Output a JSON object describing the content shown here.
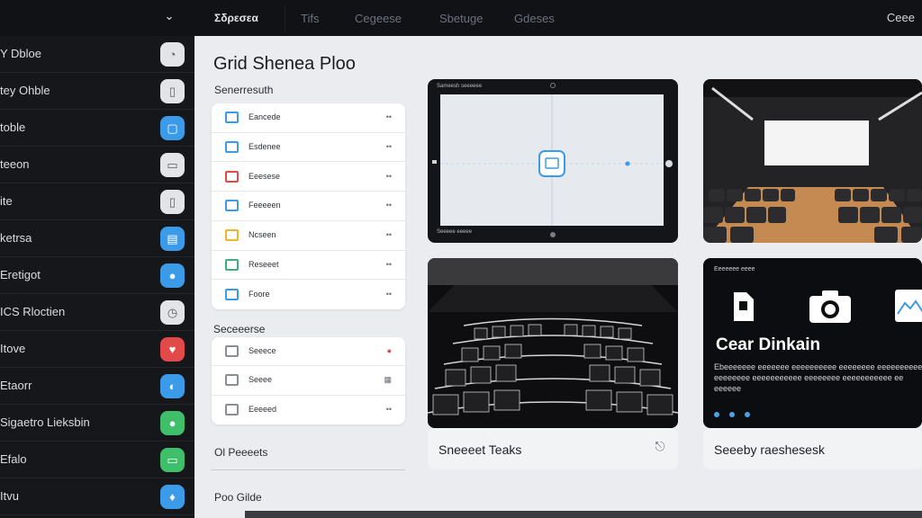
{
  "topbar": {
    "tabs": [
      "Σδρεσεα",
      "Tifs",
      "Cegeese",
      "Sbetuge",
      "Gdeses"
    ],
    "right": "Ceee"
  },
  "sidebar": {
    "items": [
      {
        "label": "Y Dbloe",
        "icon": "note-icon",
        "color": "#e3e4e7",
        "glyph": "◔"
      },
      {
        "label": "tey Ohble",
        "icon": "device-icon",
        "color": "#e3e4e7",
        "glyph": "▯"
      },
      {
        "label": "toble",
        "icon": "app-icon",
        "color": "#3c9be8",
        "glyph": "▢"
      },
      {
        "label": "teeon",
        "icon": "keyboard-icon",
        "color": "#e3e4e7",
        "glyph": "▭"
      },
      {
        "label": "ite",
        "icon": "phone-icon",
        "color": "#e3e4e7",
        "glyph": "▯"
      },
      {
        "label": "ketrsa",
        "icon": "doc-icon",
        "color": "#3c9be8",
        "glyph": "▤"
      },
      {
        "label": "Eretigot",
        "icon": "chat-icon",
        "color": "#3c9be8",
        "glyph": "●"
      },
      {
        "label": "ICS Rloctien",
        "icon": "clock-icon",
        "color": "#e3e4e7",
        "glyph": "◷"
      },
      {
        "label": "Itove",
        "icon": "heart-icon",
        "color": "#e24a4a",
        "glyph": "♥"
      },
      {
        "label": "Etaorr",
        "icon": "chat-icon",
        "color": "#3c9be8",
        "glyph": "◐"
      },
      {
        "label": "Sigaetro Lieksbin",
        "icon": "message-icon",
        "color": "#3fbf6a",
        "glyph": "●"
      },
      {
        "label": "Efalo",
        "icon": "chat-icon",
        "color": "#3fbf6a",
        "glyph": "▭"
      },
      {
        "label": "Itvu",
        "icon": "tooth-icon",
        "color": "#3c9be8",
        "glyph": "♦"
      }
    ]
  },
  "main": {
    "title": "Grid Shenea Ploo",
    "section1": "Senerresuth",
    "list1": [
      {
        "label": "Eancede",
        "end": "••",
        "color": "#3c9be8"
      },
      {
        "label": "Esdenee",
        "end": "••",
        "color": "#3c9be8"
      },
      {
        "label": "Eeesese",
        "end": "••",
        "color": "#e24a4a"
      },
      {
        "label": "Feeeeen",
        "end": "••",
        "color": "#3c9be8"
      },
      {
        "label": "Ncseen",
        "end": "••",
        "color": "#f0b32a"
      },
      {
        "label": "Reseeet",
        "end": "••",
        "color": "#3fae7b"
      },
      {
        "label": "Foore",
        "end": "••",
        "color": "#3c9be8"
      }
    ],
    "section2": "Seceeerse",
    "list2": [
      {
        "label": "Seeece",
        "end": "●",
        "color": "#8b8d94"
      },
      {
        "label": "Seeee",
        "end": "▦",
        "color": "#8b8d94"
      },
      {
        "label": "Eeeeed",
        "end": "••",
        "color": "#8b8d94"
      }
    ],
    "section3": "Ol Peeeets",
    "section4": "Poo Gilde"
  },
  "tiles": {
    "device": {
      "top_label": "Sameesh seeeeee",
      "bottom_label": "Seeeee eeeee"
    },
    "caption1": "Sneeeet Teaks",
    "caption2": "Seeeby raeshesesk",
    "promo": {
      "label": "Eeeeeee eeee",
      "title": "Cear Dinkain",
      "desc": "Ebeeeeeee eeeeeee eeeeeeeeee eeeeeeee eeeeeeeeee eeeeeeee eeeeeeeeeee eeeeeeee eeeeeeeeeee ee eeeeee"
    }
  }
}
